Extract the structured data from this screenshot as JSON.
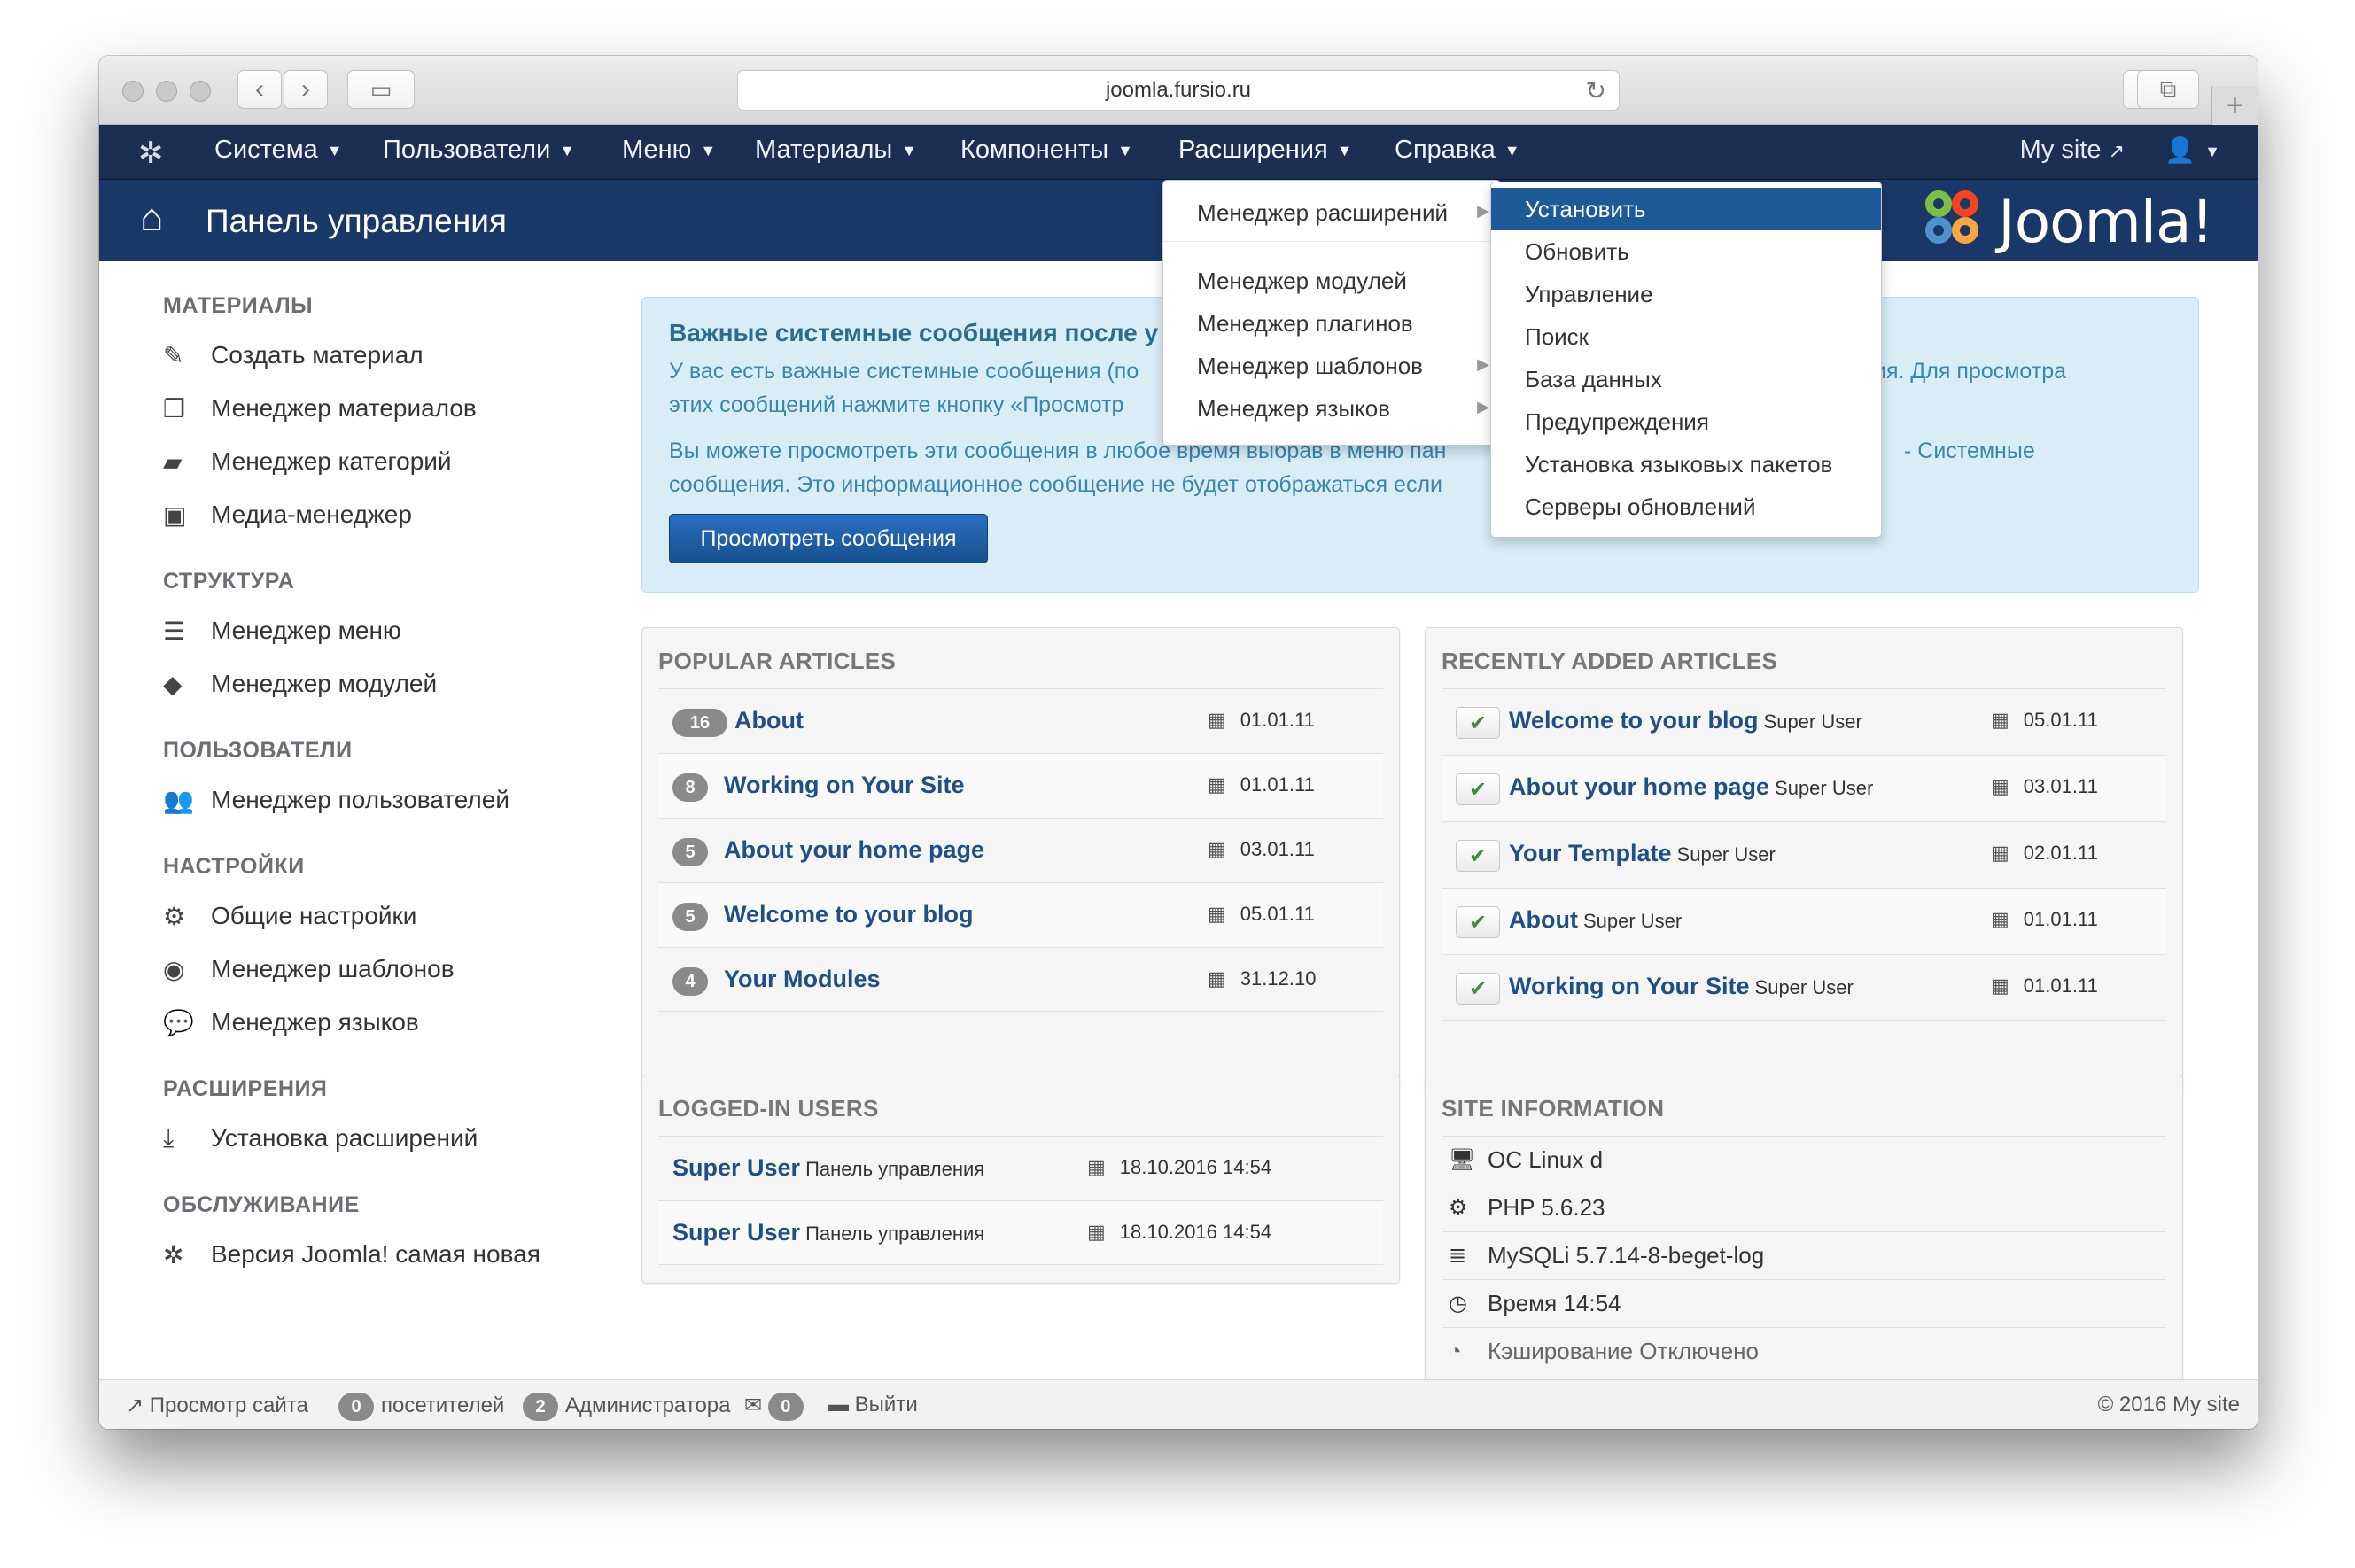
{
  "browser": {
    "url": "joomla.fursio.ru"
  },
  "topnav": {
    "items": [
      {
        "label": "Система"
      },
      {
        "label": "Пользователи"
      },
      {
        "label": "Меню"
      },
      {
        "label": "Материалы"
      },
      {
        "label": "Компоненты"
      },
      {
        "label": "Расширения"
      },
      {
        "label": "Справка"
      }
    ],
    "mysite": "My site"
  },
  "header": {
    "title": "Панель управления",
    "logo_text": "Joomla!"
  },
  "sidebar": {
    "sections": [
      {
        "title": "МАТЕРИАЛЫ",
        "items": [
          "Создать материал",
          "Менеджер материалов",
          "Менеджер категорий",
          "Медиа-менеджер"
        ]
      },
      {
        "title": "СТРУКТУРА",
        "items": [
          "Менеджер меню",
          "Менеджер модулей"
        ]
      },
      {
        "title": "ПОЛЬЗОВАТЕЛИ",
        "items": [
          "Менеджер пользователей"
        ]
      },
      {
        "title": "НАСТРОЙКИ",
        "items": [
          "Общие настройки",
          "Менеджер шаблонов",
          "Менеджер языков"
        ]
      },
      {
        "title": "РАСШИРЕНИЯ",
        "items": [
          "Установка расширений"
        ]
      },
      {
        "title": "ОБСЛУЖИВАНИЕ",
        "items": [
          "Версия Joomla! самая новая"
        ]
      }
    ]
  },
  "alert": {
    "heading": "Важные системные сообщения после у",
    "p1_line1": "У вас есть важные системные сообщения (по",
    "p1_line1_right": "ия. Для просмотра",
    "p1_line2": "этих сообщений нажмите кнопку «Просмотр",
    "p2_line1": "Вы можете просмотреть эти сообщения в любое время выбрав в меню пан",
    "p2_line1_right": "- Системные",
    "p2_line2": "сообщения. Это информационное сообщение не будет отображаться если",
    "button": "Просмотреть сообщения"
  },
  "popular": {
    "title": "POPULAR ARTICLES",
    "rows": [
      {
        "count": "16",
        "title": "About",
        "date": "01.01.11"
      },
      {
        "count": "8",
        "title": "Working on Your Site",
        "date": "01.01.11"
      },
      {
        "count": "5",
        "title": "About your home page",
        "date": "03.01.11"
      },
      {
        "count": "5",
        "title": "Welcome to your blog",
        "date": "05.01.11"
      },
      {
        "count": "4",
        "title": "Your Modules",
        "date": "31.12.10"
      }
    ]
  },
  "recent": {
    "title": "RECENTLY ADDED ARTICLES",
    "rows": [
      {
        "title": "Welcome to your blog",
        "author": "Super User",
        "date": "05.01.11"
      },
      {
        "title": "About your home page",
        "author": "Super User",
        "date": "03.01.11"
      },
      {
        "title": "Your Template",
        "author": "Super User",
        "date": "02.01.11"
      },
      {
        "title": "About",
        "author": "Super User",
        "date": "01.01.11"
      },
      {
        "title": "Working on Your Site",
        "author": "Super User",
        "date": "01.01.11"
      }
    ]
  },
  "logged": {
    "title": "LOGGED-IN USERS",
    "rows": [
      {
        "name": "Super User",
        "where": "Панель управления",
        "date": "18.10.2016 14:54"
      },
      {
        "name": "Super User",
        "where": "Панель управления",
        "date": "18.10.2016 14:54"
      }
    ]
  },
  "siteinfo": {
    "title": "SITE INFORMATION",
    "rows": [
      "ОС Linux d",
      "PHP 5.6.23",
      "MySQLi 5.7.14-8-beget-log",
      "Время 14:54",
      "Кэширование Отключено"
    ]
  },
  "dropdown": {
    "items": [
      "Менеджер расширений",
      "Менеджер модулей",
      "Менеджер плагинов",
      "Менеджер шаблонов",
      "Менеджер языков"
    ]
  },
  "submenu": {
    "items": [
      "Установить",
      "Обновить",
      "Управление",
      "Поиск",
      "База данных",
      "Предупреждения",
      "Установка языковых пакетов",
      "Серверы обновлений"
    ]
  },
  "status": {
    "view_site": "Просмотр сайта",
    "visitors_count": "0",
    "visitors": "посетителей",
    "admins_count": "2",
    "admins": "Администратора",
    "messages_count": "0",
    "logout": "Выйти",
    "copyright": "© 2016 My site"
  },
  "colors": {
    "nav": "#1b2f52",
    "header": "#1a3867",
    "link": "#1f4f86",
    "alert_bg": "#d9edf7",
    "selected": "#1d5a97"
  }
}
